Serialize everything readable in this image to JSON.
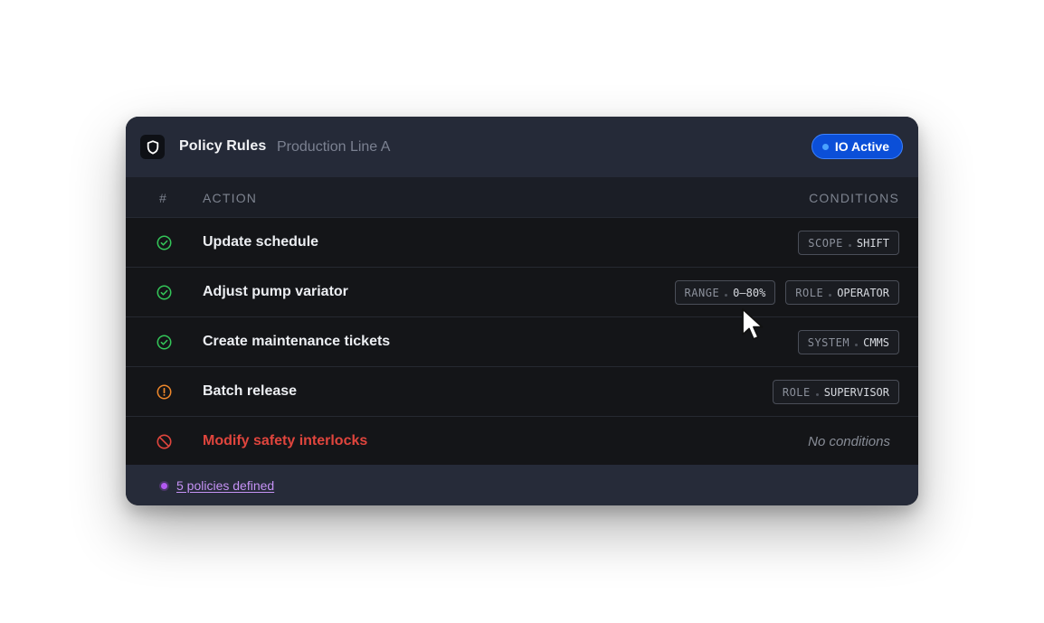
{
  "header": {
    "title": "Policy Rules",
    "subtitle": "Production Line A",
    "status_badge": "IO Active"
  },
  "columns": {
    "index": "#",
    "action": "ACTION",
    "conditions": "CONDITIONS"
  },
  "rows": [
    {
      "status": "allowed",
      "status_icon": "check-circle-icon",
      "action": "Update schedule",
      "conditions": [
        {
          "key": "SCOPE",
          "value": "SHIFT"
        }
      ]
    },
    {
      "status": "allowed",
      "status_icon": "check-circle-icon",
      "action": "Adjust pump variator",
      "conditions": [
        {
          "key": "RANGE",
          "value": "0–80%"
        },
        {
          "key": "ROLE",
          "value": "OPERATOR"
        }
      ]
    },
    {
      "status": "allowed",
      "status_icon": "check-circle-icon",
      "action": "Create maintenance tickets",
      "conditions": [
        {
          "key": "SYSTEM",
          "value": "CMMS"
        }
      ]
    },
    {
      "status": "warning",
      "status_icon": "alert-circle-icon",
      "action": "Batch release",
      "conditions": [
        {
          "key": "ROLE",
          "value": "SUPERVISOR"
        }
      ]
    },
    {
      "status": "blocked",
      "status_icon": "blocked-circle-icon",
      "action": "Modify safety interlocks",
      "conditions": [],
      "no_conditions_text": "No conditions"
    }
  ],
  "footer": {
    "policies_link": "5 policies defined"
  },
  "colors": {
    "allowed": "#34c759",
    "warning": "#f0882b",
    "blocked": "#e0453d",
    "accent_blue": "#0b4fd8",
    "link_purple": "#c592f5"
  }
}
